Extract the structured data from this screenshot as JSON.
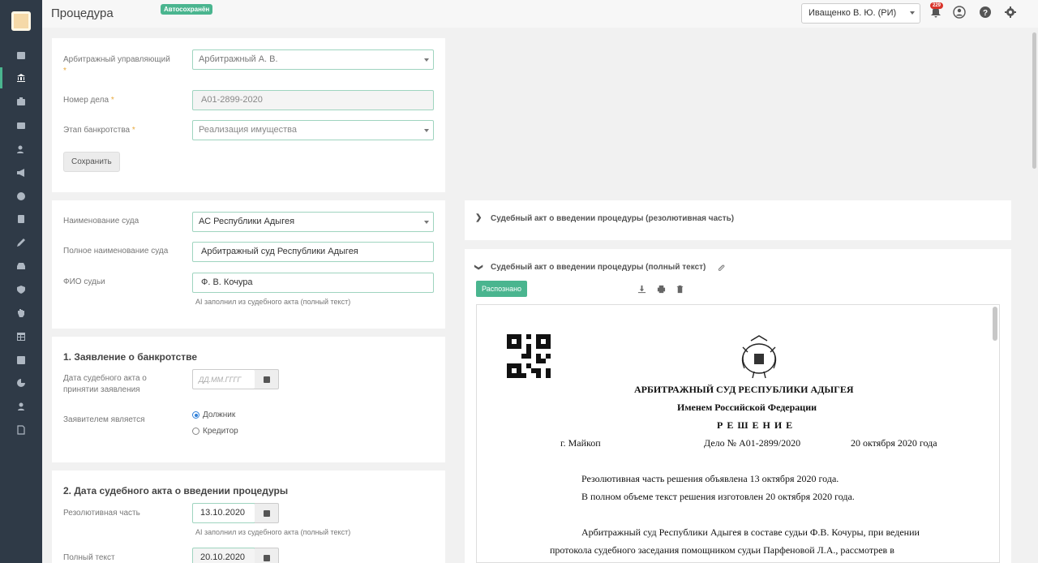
{
  "header": {
    "title": "Процедура",
    "autosave_badge": "Автосохранён",
    "user": "Иващенко В. Ю. (РИ)",
    "notifications_count": "229"
  },
  "sidebar": {
    "icons": [
      "calendar-icon",
      "bank-icon",
      "briefcase-icon",
      "case-icon",
      "add-user-icon",
      "megaphone-icon",
      "dollar-icon",
      "calculator-icon",
      "pen-icon",
      "car-icon",
      "shield-icon",
      "hand-icon",
      "table-icon",
      "list-icon",
      "pie-chart-icon",
      "users-icon",
      "document-icon"
    ]
  },
  "card1": {
    "manager_label": "Арбитражный управляющий",
    "manager_value": "Арбитражный А. В.",
    "case_label": "Номер дела",
    "case_value": "А01-2899-2020",
    "stage_label": "Этап банкротства",
    "stage_value": "Реализация имущества",
    "required_mark": "*",
    "save_button": "Сохранить"
  },
  "card2": {
    "court_label": "Наименование суда",
    "court_value": "АС Республики Адыгея",
    "full_court_label": "Полное наименование суда",
    "full_court_value": "Арбитражный суд Республики Адыгея",
    "judge_label": "ФИО судьи",
    "judge_value": "Ф. В. Кочура",
    "judge_hint": "AI заполнил из судебного акта (полный текст)"
  },
  "card3": {
    "title": "1. Заявление о банкротстве",
    "date_label": "Дата судебного акта о принятии заявления",
    "date_placeholder": "ДД.ММ.ГГГГ",
    "applicant_label": "Заявителем является",
    "option_debtor": "Должник",
    "option_creditor": "Кредитор"
  },
  "card4": {
    "title": "2. Дата судебного акта о введении процедуры",
    "resolutive_label": "Резолютивная часть",
    "resolutive_value": "13.10.2020",
    "resolutive_hint": "AI заполнил из судебного акта (полный текст)",
    "full_label": "Полный текст",
    "full_value": "20.10.2020"
  },
  "right": {
    "acc1_title": "Судебный акт о введении процедуры (резолютивная часть)",
    "acc2_title": "Судебный акт о введении процедуры (полный текст)",
    "recognized": "Распознано"
  },
  "document": {
    "court": "АРБИТРАЖНЫЙ СУД РЕСПУБЛИКИ АДЫГЕЯ",
    "name_of": "Именем Российской Федерации",
    "decision": "Р Е Ш Е Н И Е",
    "city": "г. Майкоп",
    "case": "Дело №  А01-2899/2020",
    "date": "20 октября 2020 года",
    "line1": "Резолютивная часть решения объявлена 13 октября 2020 года.",
    "line2": "В полном объеме текст решения изготовлен  20 октября 2020 года.",
    "line3": "Арбитражный суд Республики Адыгея  в составе  судьи Ф.В. Кочуры, при ведении",
    "line4": "протокола  судебного  заседания  помощником  судьи  Парфеновой  Л.А.,  рассмотрев  в"
  }
}
